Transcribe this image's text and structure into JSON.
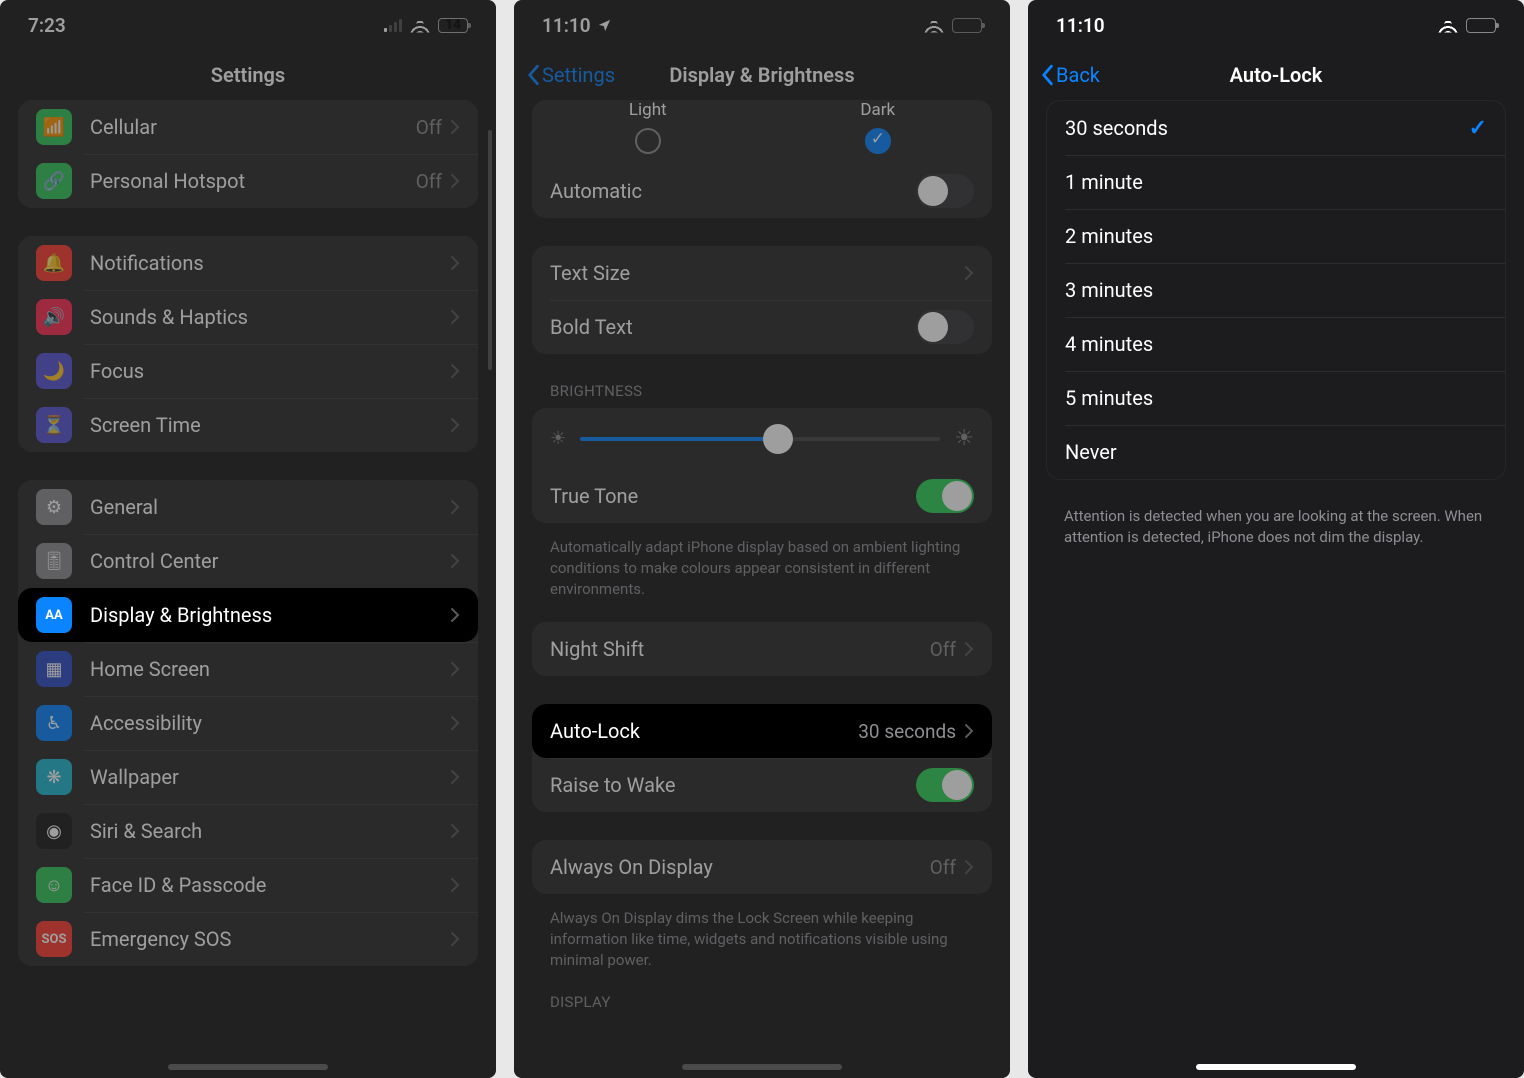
{
  "pane1": {
    "status": {
      "time": "7:23",
      "battery_pct": "14"
    },
    "title": "Settings",
    "groupA": [
      {
        "icon": "antenna",
        "color": "#34c759",
        "label": "Cellular",
        "value": "Off"
      },
      {
        "icon": "link",
        "color": "#34c759",
        "label": "Personal Hotspot",
        "value": "Off"
      }
    ],
    "groupB": [
      {
        "icon": "bell",
        "color": "#ff3b30",
        "label": "Notifications"
      },
      {
        "icon": "sound",
        "color": "#ff2d55",
        "label": "Sounds & Haptics"
      },
      {
        "icon": "moon",
        "color": "#5856d6",
        "label": "Focus"
      },
      {
        "icon": "timer",
        "color": "#5856d6",
        "label": "Screen Time"
      }
    ],
    "groupC": [
      {
        "icon": "gear",
        "color": "#8e8e93",
        "label": "General"
      },
      {
        "icon": "switches",
        "color": "#8e8e93",
        "label": "Control Center"
      },
      {
        "icon": "AA",
        "color": "#0a84ff",
        "label": "Display & Brightness",
        "hl": true
      },
      {
        "icon": "grid",
        "color": "#2f4ec7",
        "label": "Home Screen"
      },
      {
        "icon": "access",
        "color": "#0a84ff",
        "label": "Accessibility"
      },
      {
        "icon": "flower",
        "color": "#22b8cf",
        "label": "Wallpaper"
      },
      {
        "icon": "siri",
        "color": "#1c1c1e",
        "label": "Siri & Search"
      },
      {
        "icon": "face",
        "color": "#34c759",
        "label": "Face ID & Passcode"
      },
      {
        "icon": "sos",
        "color": "#ff3b30",
        "label": "Emergency SOS"
      }
    ]
  },
  "pane2": {
    "status": {
      "time": "11:10"
    },
    "back": "Settings",
    "title": "Display & Brightness",
    "appearance": {
      "opt1": "Light",
      "opt2": "Dark",
      "selected": 2
    },
    "automatic_label": "Automatic",
    "textsize_label": "Text Size",
    "boldtext_label": "Bold Text",
    "brightness_header": "BRIGHTNESS",
    "brightness_pct": 55,
    "truetone_label": "True Tone",
    "truetone_footer": "Automatically adapt iPhone display based on ambient lighting conditions to make colours appear consistent in different environments.",
    "nightshift_label": "Night Shift",
    "nightshift_value": "Off",
    "autolock_label": "Auto-Lock",
    "autolock_value": "30 seconds",
    "raise_label": "Raise to Wake",
    "aod_label": "Always On Display",
    "aod_value": "Off",
    "aod_footer": "Always On Display dims the Lock Screen while keeping information like time, widgets and notifications visible using minimal power.",
    "display_header": "DISPLAY"
  },
  "pane3": {
    "status": {
      "time": "11:10"
    },
    "back": "Back",
    "title": "Auto-Lock",
    "options": [
      "30 seconds",
      "1 minute",
      "2 minutes",
      "3 minutes",
      "4 minutes",
      "5 minutes",
      "Never"
    ],
    "selected_index": 0,
    "footer": "Attention is detected when you are looking at the screen. When attention is detected, iPhone does not dim the display."
  }
}
